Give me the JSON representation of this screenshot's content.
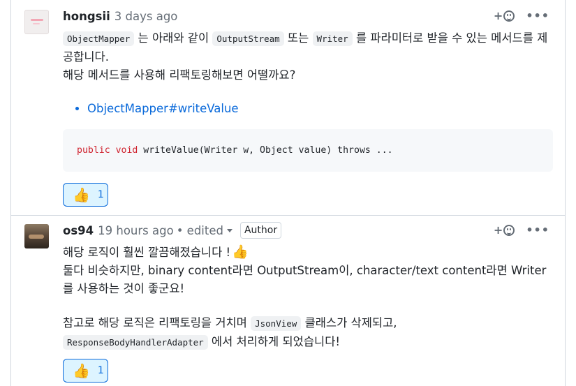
{
  "comments": [
    {
      "author": "hongsii",
      "time": "3 days ago",
      "body": {
        "p1_code1": "ObjectMapper",
        "p1_text1": " 는 아래와 같이 ",
        "p1_code2": "OutputStream",
        "p1_text2": " 또는 ",
        "p1_code3": "Writer",
        "p1_text3": " 를 파라미터로 받을 수 있는 메서드를 제공합니다.",
        "p1_line2": "해당 메서드를 사용해 리팩토링해보면 어떨까요?",
        "link": "ObjectMapper#writeValue",
        "code_kw1": "public",
        "code_kw2": "void",
        "code_rest": " writeValue(Writer w, Object value) throws ..."
      },
      "reaction": {
        "emoji": "👍",
        "count": "1"
      }
    },
    {
      "author": "os94",
      "time": "19 hours ago",
      "edited": "• edited",
      "badge": "Author",
      "body": {
        "line1": "해당 로직이 훨씬 깔끔해졌습니다 !",
        "line1_emoji": "👍",
        "line2": "둘다 비슷하지만, binary content라면 OutputStream이, character/text content라면 Writer를 사용하는 것이 좋군요!",
        "p2_text1": "참고로 해당 로직은 리팩토링을 거치며 ",
        "p2_code1": "JsonView",
        "p2_text2": " 클래스가 삭제되고,",
        "p2_code2": "ResponseBodyHandlerAdapter",
        "p2_text3": " 에서 처리하게 되었습니다!"
      },
      "reaction": {
        "emoji": "👍",
        "count": "1"
      }
    }
  ],
  "actions": {
    "add_reaction": "+",
    "more": "•••"
  },
  "icons": [
    "smiley-icon",
    "kebab-icon",
    "thumbs-up-icon",
    "caret-down-icon"
  ],
  "colors": {
    "link": "#0969da",
    "keyword": "#cf222e",
    "muted": "#656d76",
    "reaction_bg": "#ddf4ff"
  }
}
